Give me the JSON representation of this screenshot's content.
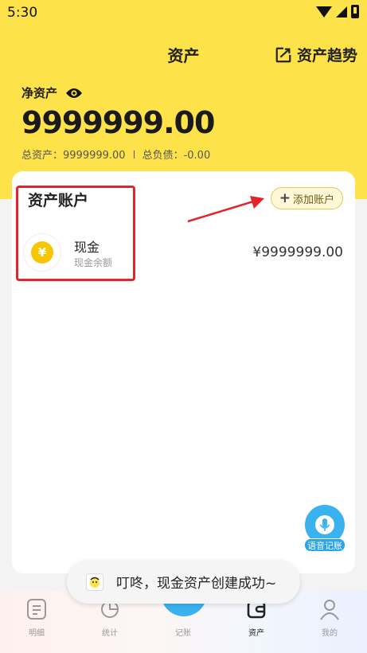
{
  "status_bar": {
    "time": "5:30"
  },
  "header": {
    "title": "资产",
    "trend_label": "资产趋势"
  },
  "net_assets": {
    "label": "净资产",
    "value": "9999999.00",
    "total_assets": "总资产：9999999.00",
    "total_debt": "总负债：-0.00"
  },
  "accounts_card": {
    "title": "资产账户",
    "add_label": "添加账户",
    "items": [
      {
        "name": "现金",
        "subtitle": "现金余额",
        "amount": "¥9999999.00",
        "icon": "yen-coin-icon"
      }
    ]
  },
  "voice_button": {
    "label": "语音记账"
  },
  "toast": {
    "message": "叮咚，现金资产创建成功~"
  },
  "tabbar": {
    "items": [
      {
        "label": "明细",
        "icon": "list-icon"
      },
      {
        "label": "统计",
        "icon": "pie-icon"
      },
      {
        "label": "记账",
        "icon": "add-icon"
      },
      {
        "label": "资产",
        "icon": "wallet-icon"
      },
      {
        "label": "我的",
        "icon": "user-icon"
      }
    ],
    "active": "资产"
  },
  "colors": {
    "brand_yellow": "#fde24a",
    "accent_blue": "#3ab2ee",
    "annotation_red": "#e0262d"
  }
}
